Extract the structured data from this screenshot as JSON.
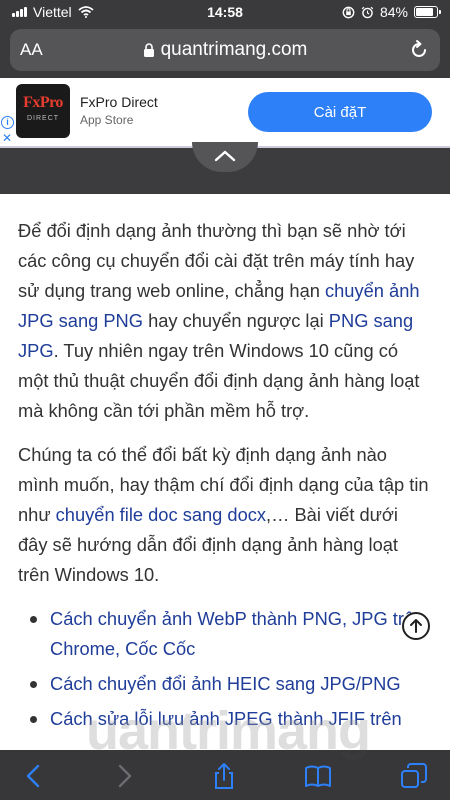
{
  "status_bar": {
    "carrier": "Viettel",
    "time": "14:58",
    "battery": "84%",
    "battery_level": 0.84
  },
  "address_bar": {
    "text_size_label": "AA",
    "url": "quantrimang.com"
  },
  "ad": {
    "logo_text": "FxPro",
    "logo_subtext": "DIRECT",
    "title": "FxPro Direct",
    "store": "App Store",
    "button_label": "Cài đặT"
  },
  "article": {
    "p1": [
      {
        "t": "Để đổi định dạng ảnh thường thì bạn sẽ nhờ tới các công cụ chuyển đổi cài đặt trên máy tính hay sử dụng trang web online, chẳng hạn "
      },
      {
        "t": "chuyển ảnh JPG sang PNG",
        "link": true
      },
      {
        "t": " hay chuyển ngược lại "
      },
      {
        "t": "PNG sang JPG",
        "link": true
      },
      {
        "t": ". Tuy nhiên ngay trên Windows 10 cũng có một thủ thuật chuyển đổi định dạng ảnh hàng loạt mà không cần tới phần mềm hỗ trợ."
      }
    ],
    "p2": [
      {
        "t": "Chúng ta có thể đổi bất kỳ định dạng ảnh nào mình muốn, hay thậm chí đổi định dạng của tập tin như "
      },
      {
        "t": "chuyển file doc sang docx",
        "link": true
      },
      {
        "t": ",… Bài viết dưới đây sẽ hướng dẫn đổi định dạng ảnh hàng loạt trên Windows 10."
      }
    ],
    "links": [
      "Cách chuyển ảnh WebP thành PNG, JPG trên Chrome, Cốc Cốc",
      "Cách chuyển đổi ảnh HEIC sang JPG/PNG",
      "Cách sửa lỗi lưu ảnh JPEG thành JFIF trên"
    ]
  },
  "watermark": "uantrimang",
  "colors": {
    "link": "#1f3d99",
    "install_button": "#2d80f7",
    "toolbar_icon": "#2d80f7"
  }
}
